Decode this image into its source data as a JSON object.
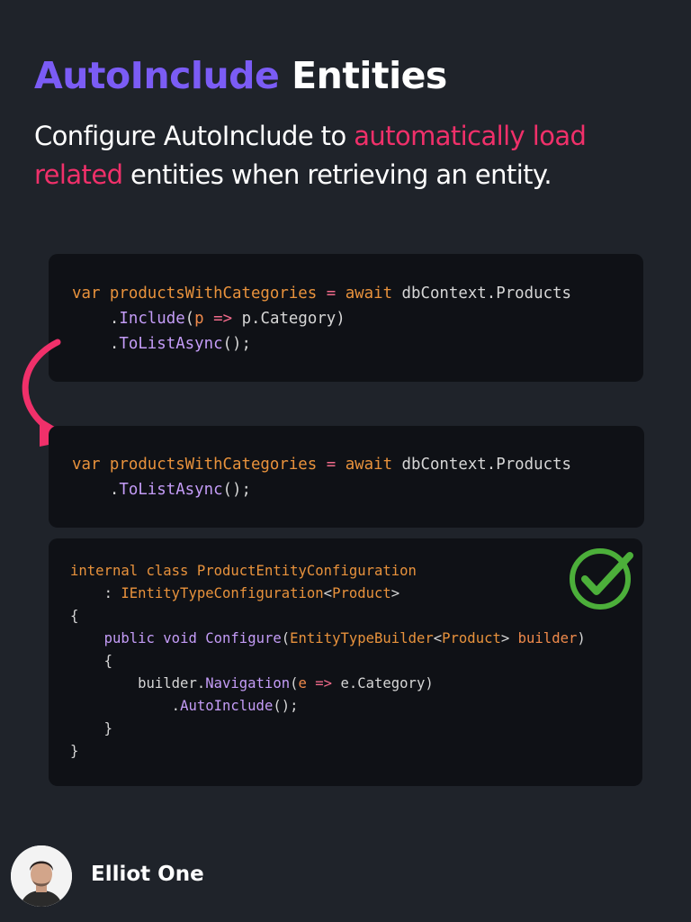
{
  "header": {
    "title_accent": "AutoInclude",
    "title_rest": "Entities",
    "subtitle_start": "Configure AutoInclude to ",
    "subtitle_highlight": "automatically load related",
    "subtitle_end": " entities when retrieving an entity."
  },
  "code_before": {
    "lines": [
      "var productsWithCategories = await dbContext.Products",
      "    .Include(p => p.Category)",
      "    .ToListAsync();"
    ]
  },
  "code_after": {
    "lines": [
      "var productsWithCategories = await dbContext.Products",
      "    .ToListAsync();"
    ]
  },
  "code_config": {
    "lines": [
      "internal class ProductEntityConfiguration",
      "    : IEntityTypeConfiguration<Product>",
      "{",
      "    public void Configure(EntityTypeBuilder<Product> builder)",
      "    {",
      "        builder.Navigation(e => e.Category)",
      "            .AutoInclude();",
      "    }",
      "}"
    ]
  },
  "author": {
    "name": "Elliot One"
  },
  "icons": {
    "arrow": "curved-arrow-icon",
    "check": "check-circle-icon"
  },
  "colors": {
    "background": "#1f232a",
    "code_background": "#0f1116",
    "accent_purple": "#7b5cf5",
    "accent_pink": "#f0306a",
    "check_green": "#4caf3a"
  }
}
